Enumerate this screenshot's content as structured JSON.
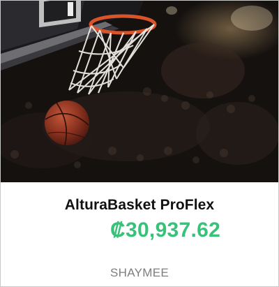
{
  "product": {
    "image_alt": "basketball going through hoop net",
    "title": "AlturaBasket ProFlex",
    "price": "₡30,937.62",
    "brand": "SHAYMEE"
  },
  "colors": {
    "price": "#37c27a",
    "title": "#111111",
    "brand": "#7d7d7d",
    "border": "#c9c9c9"
  }
}
